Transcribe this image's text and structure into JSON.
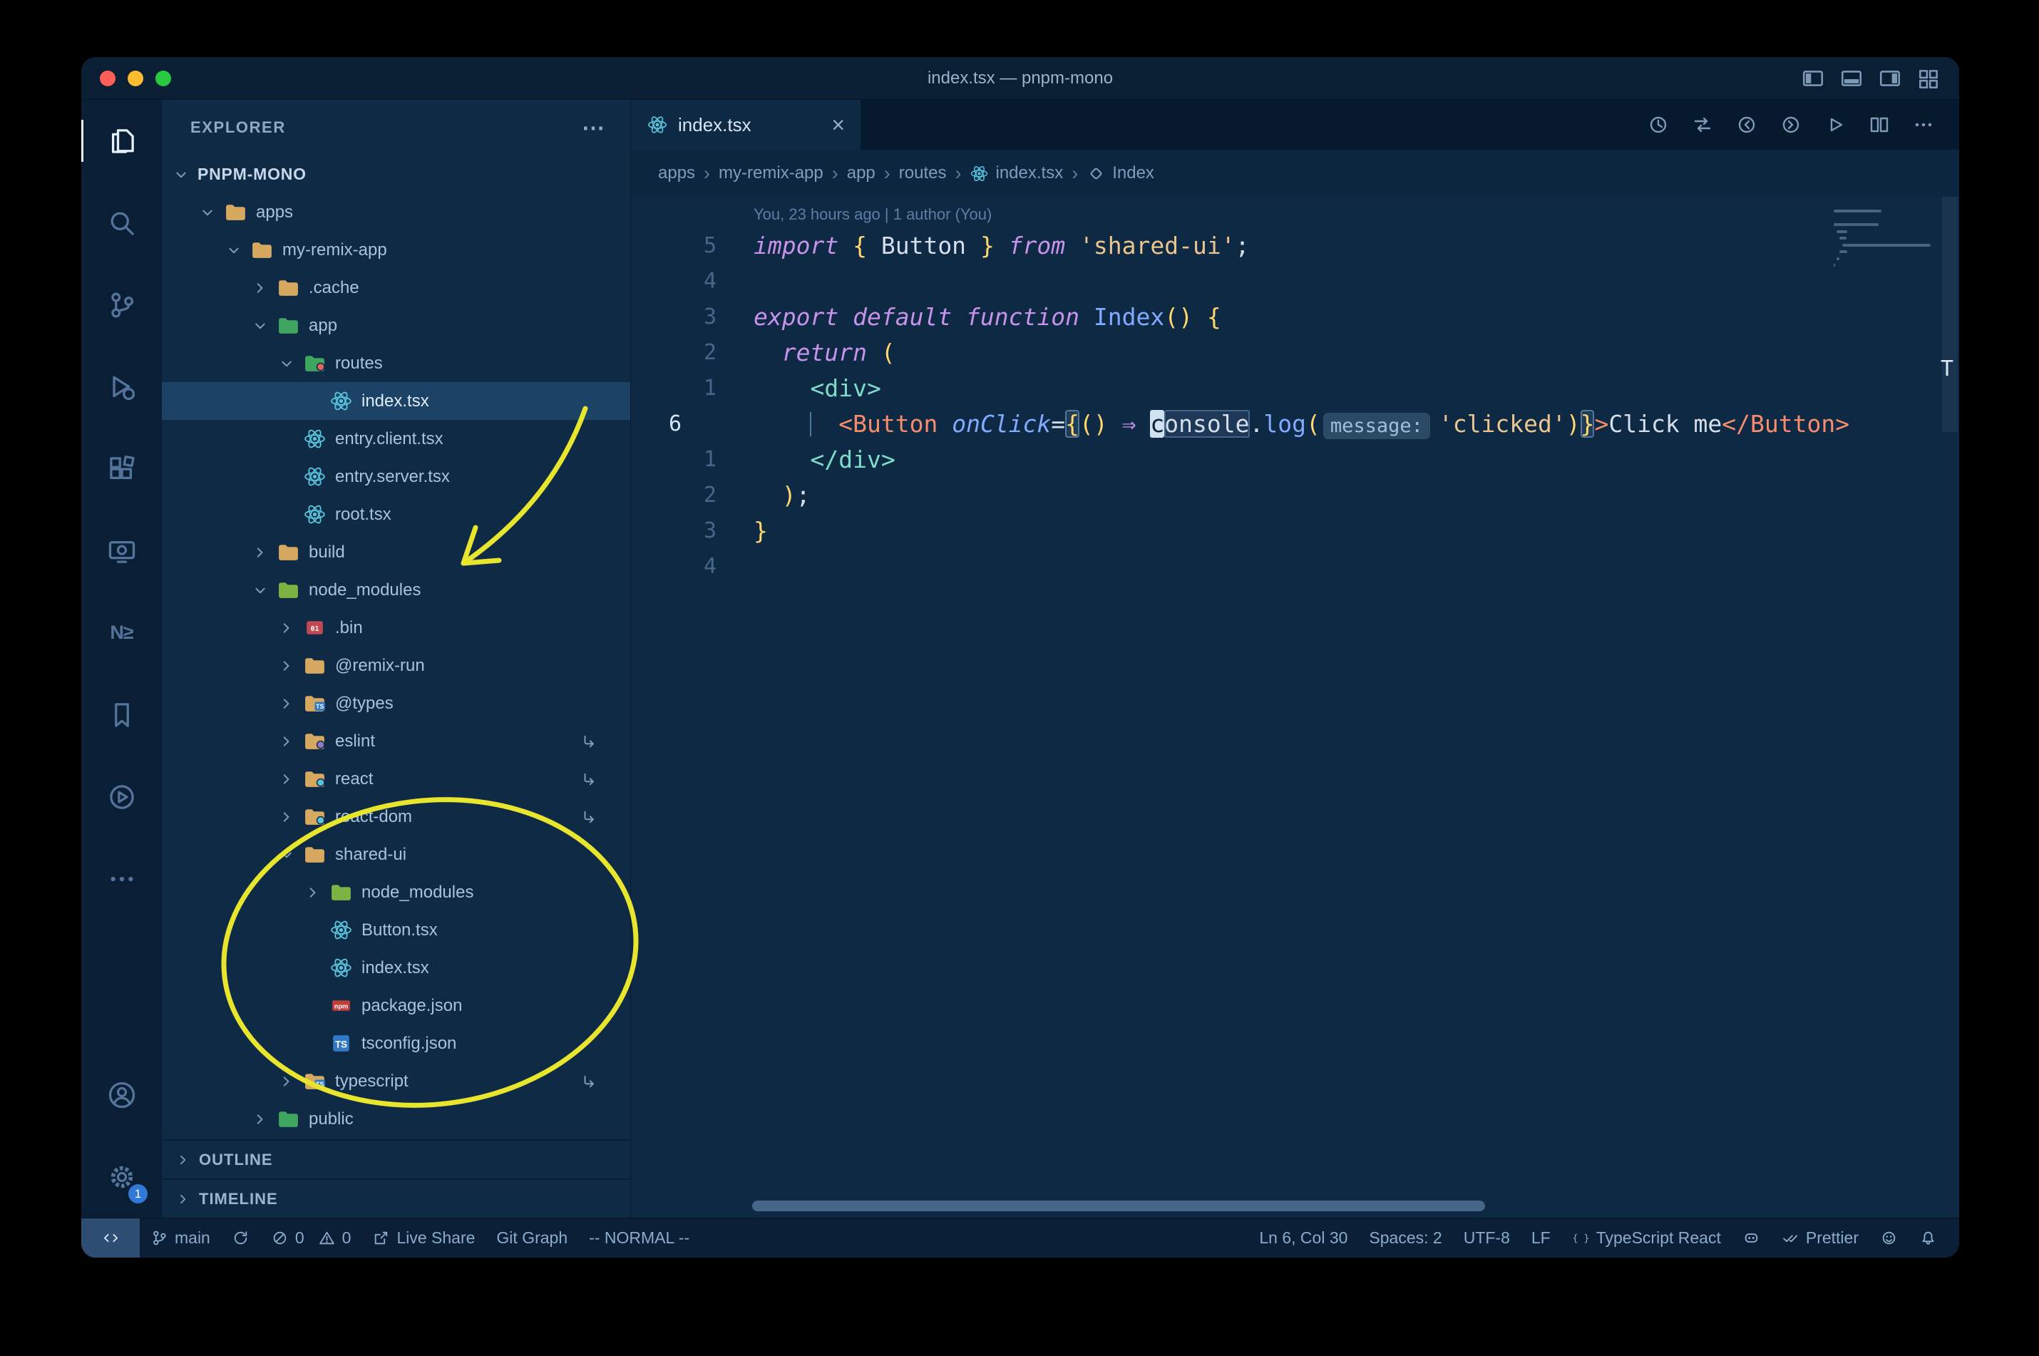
{
  "window": {
    "title": "index.tsx — pnpm-mono"
  },
  "titlebar": {
    "layout_icons": [
      {
        "name": "toggle-primary-sidebar",
        "icon": "layout-sidebar-left"
      },
      {
        "name": "toggle-panel",
        "icon": "layout-panel"
      },
      {
        "name": "toggle-secondary-sidebar",
        "icon": "layout-sidebar-right"
      },
      {
        "name": "customize-layout",
        "icon": "layout-grid"
      }
    ]
  },
  "activity_bar": {
    "items": [
      {
        "name": "explorer",
        "icon": "files",
        "active": true
      },
      {
        "name": "search",
        "icon": "search"
      },
      {
        "name": "source-control",
        "icon": "branch"
      },
      {
        "name": "run-debug",
        "icon": "debug"
      },
      {
        "name": "extensions",
        "icon": "extensions"
      },
      {
        "name": "remote-explorer",
        "icon": "monitor"
      },
      {
        "name": "nx-console",
        "icon": "text",
        "glyph": "N≥"
      },
      {
        "name": "bookmarks",
        "icon": "bookmark"
      },
      {
        "name": "play-circle",
        "icon": "play-circle"
      },
      {
        "name": "more-activity",
        "icon": "ellipsis"
      }
    ],
    "bottom": [
      {
        "name": "accounts",
        "icon": "account"
      },
      {
        "name": "settings",
        "icon": "gear",
        "badge": "1"
      }
    ]
  },
  "sidebar": {
    "title": "EXPLORER",
    "more_icon": "⋯",
    "tree": [
      {
        "label": "PNPM-MONO",
        "level": 0,
        "expanded": true,
        "root": true
      },
      {
        "label": "apps",
        "level": 1,
        "icon": "folder",
        "expanded": true
      },
      {
        "label": "my-remix-app",
        "level": 2,
        "icon": "folder",
        "expanded": true
      },
      {
        "label": ".cache",
        "level": 3,
        "icon": "folder",
        "expanded": false
      },
      {
        "label": "app",
        "level": 3,
        "icon": "folder-app",
        "expanded": true
      },
      {
        "label": "routes",
        "level": 4,
        "icon": "folder-routes",
        "expanded": true
      },
      {
        "label": "index.tsx",
        "level": 5,
        "icon": "react",
        "selected": true
      },
      {
        "label": "entry.client.tsx",
        "level": 4,
        "icon": "react"
      },
      {
        "label": "entry.server.tsx",
        "level": 4,
        "icon": "react"
      },
      {
        "label": "root.tsx",
        "level": 4,
        "icon": "react"
      },
      {
        "label": "build",
        "level": 3,
        "icon": "folder",
        "expanded": false
      },
      {
        "label": "node_modules",
        "level": 3,
        "icon": "folder-node",
        "expanded": true
      },
      {
        "label": ".bin",
        "level": 4,
        "icon": "bin",
        "expanded": false
      },
      {
        "label": "@remix-run",
        "level": 4,
        "icon": "folder",
        "expanded": false
      },
      {
        "label": "@types",
        "level": 4,
        "icon": "folder-ts",
        "expanded": false
      },
      {
        "label": "eslint",
        "level": 4,
        "icon": "folder-eslint",
        "expanded": false,
        "symlink": true
      },
      {
        "label": "react",
        "level": 4,
        "icon": "folder-react",
        "expanded": false,
        "symlink": true
      },
      {
        "label": "react-dom",
        "level": 4,
        "icon": "folder-react",
        "expanded": false,
        "symlink": true
      },
      {
        "label": "shared-ui",
        "level": 4,
        "icon": "folder",
        "expanded": true
      },
      {
        "label": "node_modules",
        "level": 5,
        "icon": "folder-node",
        "expanded": false
      },
      {
        "label": "Button.tsx",
        "level": 5,
        "icon": "react"
      },
      {
        "label": "index.tsx",
        "level": 5,
        "icon": "react"
      },
      {
        "label": "package.json",
        "level": 5,
        "icon": "npm"
      },
      {
        "label": "tsconfig.json",
        "level": 5,
        "icon": "ts"
      },
      {
        "label": "typescript",
        "level": 4,
        "icon": "folder-ts",
        "expanded": false,
        "symlink": true
      },
      {
        "label": "public",
        "level": 3,
        "icon": "folder-public",
        "expanded": false
      }
    ],
    "sections": [
      {
        "label": "OUTLINE"
      },
      {
        "label": "TIMELINE"
      }
    ]
  },
  "editor": {
    "tab": {
      "label": "index.tsx",
      "close": "×"
    },
    "actions": [
      {
        "name": "file-history",
        "icon": "history"
      },
      {
        "name": "compare-changes",
        "icon": "compare"
      },
      {
        "name": "previous-change",
        "icon": "circle-prev"
      },
      {
        "name": "next-change",
        "icon": "circle-next"
      },
      {
        "name": "run-file",
        "icon": "run"
      },
      {
        "name": "split-editor",
        "icon": "split"
      },
      {
        "name": "more-actions",
        "icon": "ellipsis"
      }
    ],
    "breadcrumbs": {
      "separator": "›",
      "items": [
        {
          "label": "apps"
        },
        {
          "label": "my-remix-app"
        },
        {
          "label": "app"
        },
        {
          "label": "routes"
        },
        {
          "label": "index.tsx",
          "icon": "react"
        },
        {
          "label": "Index",
          "icon": "symbol"
        }
      ]
    },
    "blame": "You, 23 hours ago | 1 author (You)",
    "overview_marker": "T",
    "lines": [
      {
        "num": "5",
        "tokens": [
          [
            "kw",
            "import"
          ],
          [
            "pl",
            " "
          ],
          [
            "b1",
            "{"
          ],
          [
            "pl",
            " "
          ],
          [
            "v",
            "Button"
          ],
          [
            "pl",
            " "
          ],
          [
            "b1",
            "}"
          ],
          [
            "pl",
            " "
          ],
          [
            "kw",
            "from"
          ],
          [
            "pl",
            " "
          ],
          [
            "str",
            "'shared-ui'"
          ],
          [
            "pl",
            ";"
          ]
        ]
      },
      {
        "num": "4",
        "tokens": []
      },
      {
        "num": "3",
        "tokens": [
          [
            "kw",
            "export"
          ],
          [
            "pl",
            " "
          ],
          [
            "kw",
            "default"
          ],
          [
            "pl",
            " "
          ],
          [
            "kw",
            "function"
          ],
          [
            "pl",
            " "
          ],
          [
            "fn",
            "Index"
          ],
          [
            "b1",
            "()"
          ],
          [
            "pl",
            " "
          ],
          [
            "b1",
            "{"
          ]
        ]
      },
      {
        "num": "2",
        "tokens": [
          [
            "pl",
            "  "
          ],
          [
            "kw",
            "return"
          ],
          [
            "pl",
            " "
          ],
          [
            "b1",
            "("
          ]
        ]
      },
      {
        "num": "1",
        "tokens": [
          [
            "pl",
            "    "
          ],
          [
            "tag",
            "<div>"
          ]
        ]
      },
      {
        "num": "6",
        "active": true,
        "tokens": [
          [
            "pl",
            "    "
          ],
          [
            "guide",
            ""
          ],
          [
            "pl",
            "  "
          ],
          [
            "compp",
            "<"
          ],
          [
            "comp",
            "Button"
          ],
          [
            "pl",
            " "
          ],
          [
            "attr",
            "onClick"
          ],
          [
            "op",
            "="
          ],
          [
            "bm",
            "{"
          ],
          [
            "b1",
            "()"
          ],
          [
            "pl",
            " "
          ],
          [
            "arrow",
            "⇒"
          ],
          [
            "pl",
            " "
          ],
          [
            "cursor",
            "c"
          ],
          [
            "hl",
            "onsole"
          ],
          [
            "pl",
            "."
          ],
          [
            "fn",
            "log"
          ],
          [
            "b1",
            "("
          ],
          [
            "inlay",
            "message:"
          ],
          [
            "str",
            "'clicked'"
          ],
          [
            "b1",
            ")"
          ],
          [
            "bm",
            "}"
          ],
          [
            "compp",
            ">"
          ],
          [
            "v",
            "Click me"
          ],
          [
            "compp",
            "</"
          ],
          [
            "comp",
            "Button"
          ],
          [
            "compp",
            ">"
          ]
        ]
      },
      {
        "num": "1",
        "tokens": [
          [
            "pl",
            "    "
          ],
          [
            "tag",
            "</div>"
          ]
        ]
      },
      {
        "num": "2",
        "tokens": [
          [
            "pl",
            "  "
          ],
          [
            "b1",
            ")"
          ],
          [
            "pl",
            ";"
          ]
        ]
      },
      {
        "num": "3",
        "tokens": [
          [
            "b1",
            "}"
          ]
        ]
      },
      {
        "num": "4",
        "tokens": []
      }
    ]
  },
  "status_bar": {
    "left": [
      {
        "name": "remote-indicator",
        "icon": "remote",
        "remote": true
      },
      {
        "name": "git-branch",
        "icon": "gitbranch",
        "label": "main"
      },
      {
        "name": "publish-changes",
        "icon": "sync"
      },
      {
        "name": "problems-errors",
        "icon": "error",
        "label": "0"
      },
      {
        "name": "problems-warnings",
        "icon": "warning",
        "label": "0",
        "tight": true
      },
      {
        "name": "live-share",
        "icon": "share",
        "label": "Live Share"
      },
      {
        "name": "git-graph",
        "label": "Git Graph"
      },
      {
        "name": "vim-mode",
        "label": "-- NORMAL --"
      }
    ],
    "right": [
      {
        "name": "cursor-position",
        "label": "Ln 6, Col 30"
      },
      {
        "name": "indentation",
        "label": "Spaces: 2"
      },
      {
        "name": "encoding",
        "label": "UTF-8"
      },
      {
        "name": "eol-sequence",
        "label": "LF"
      },
      {
        "name": "language-mode",
        "icon": "braces",
        "label": "TypeScript React"
      },
      {
        "name": "copilot",
        "icon": "copilot"
      },
      {
        "name": "prettier",
        "icon": "doublecheck",
        "label": "Prettier"
      },
      {
        "name": "feedback",
        "icon": "smiley"
      },
      {
        "name": "notifications",
        "icon": "bell"
      }
    ]
  },
  "annotations": {
    "color": "#e8e52f"
  }
}
